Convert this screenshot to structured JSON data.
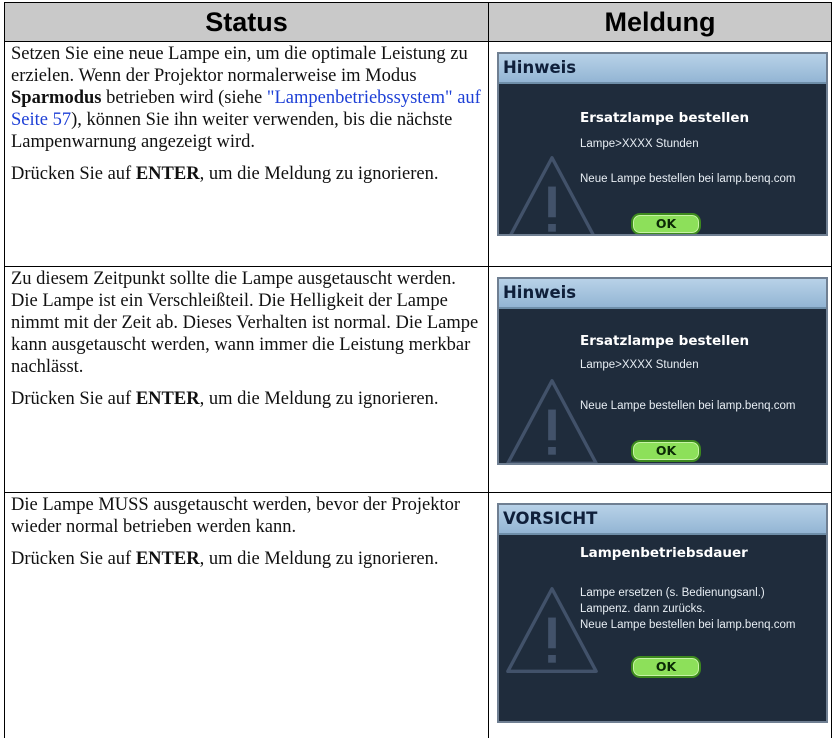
{
  "header": {
    "status": "Status",
    "message": "Meldung"
  },
  "rows": [
    {
      "status_paragraphs": [
        {
          "pre": "Setzen Sie eine neue Lampe ein, um die optimale Leistung zu erzielen. Wenn der Projektor normalerweise im Modus ",
          "bold": "Sparmodus",
          "mid": " betrieben wird (siehe ",
          "link": "\"Lampenbetriebssystem\" auf Seite 57",
          "post": "), können Sie ihn weiter verwenden, bis die nächste Lampenwarnung angezeigt wird."
        },
        {
          "pre": "Drücken Sie auf ",
          "bold": "ENTER",
          "post": ", um die Meldung zu ignorieren."
        }
      ],
      "dialog": {
        "header": "Hinweis",
        "title": "Ersatzlampe bestellen",
        "line1": "Lampe>XXXX Stunden",
        "line2": "Neue Lampe bestellen bei lamp.benq.com",
        "ok": "OK"
      }
    },
    {
      "status_paragraphs": [
        {
          "pre": "Zu diesem Zeitpunkt sollte die Lampe ausgetauscht werden. Die Lampe ist ein Verschleißteil. Die Helligkeit der Lampe nimmt mit der Zeit ab. Dieses Verhalten ist normal. Die Lampe kann ausgetauscht werden, wann immer die Leistung merkbar nachlässt."
        },
        {
          "pre": "Drücken Sie auf ",
          "bold": "ENTER",
          "post": ", um die Meldung zu ignorieren."
        }
      ],
      "dialog": {
        "header": "Hinweis",
        "title": "Ersatzlampe bestellen",
        "line1": "Lampe>XXXX Stunden",
        "line2": "Neue Lampe bestellen bei lamp.benq.com",
        "ok": "OK"
      }
    },
    {
      "status_paragraphs": [
        {
          "pre": "Die Lampe MUSS ausgetauscht werden, bevor der Projektor wieder normal betrieben werden kann."
        },
        {
          "pre": "Drücken Sie auf ",
          "bold": "ENTER",
          "post": ", um die Meldung zu ignorieren."
        }
      ],
      "dialog": {
        "header": "VORSICHT",
        "title": "Lampenbetriebsdauer",
        "line1": "Lampe ersetzen (s. Bedienungsanl.)",
        "line2": "Lampenz. dann zurücks.",
        "line3": "Neue Lampe bestellen bei lamp.benq.com",
        "ok": "OK"
      }
    }
  ]
}
